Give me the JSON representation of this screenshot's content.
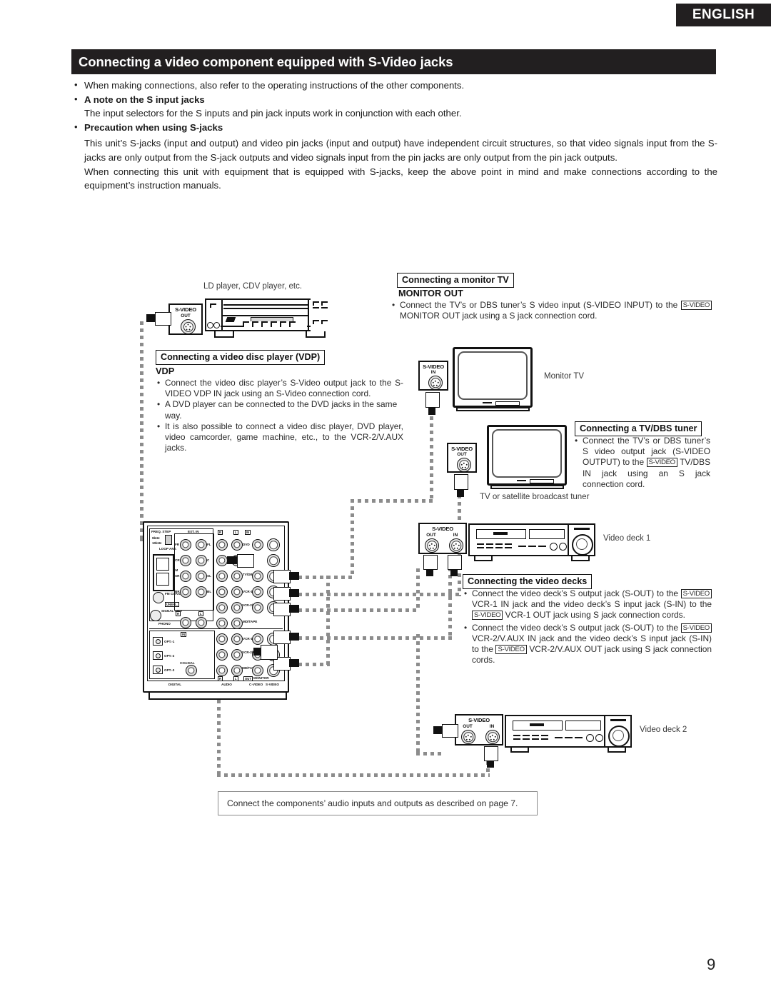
{
  "header": {
    "language_tab": "ENGLISH",
    "title": "Connecting a video component equipped with S-Video jacks"
  },
  "intro": {
    "bullet1": "When making connections, also refer to the operating instructions of the other components.",
    "bullet2_head": "A note on the S input jacks",
    "bullet2_body": "The input selectors for the S inputs and pin jack inputs work in conjunction with each other.",
    "bullet3_head": "Precaution when using S-jacks",
    "bullet3_p1": "This unit’s S-jacks (input and output) and video pin jacks (input and output) have independent circuit structures, so that video signals input  from the S-jacks are only output from the S-jack outputs and video signals input from the pin jacks are only output from the pin jack outputs.",
    "bullet3_p2": "When connecting this unit with equipment that is equipped with S-jacks, keep the above point in mind and make connections according to the equipment’s instruction manuals."
  },
  "diagram": {
    "ld_player_label": "LD player, CDV player, etc.",
    "monitor_tv_label": "Monitor TV",
    "tuner_label": "TV or satellite broadcast tuner",
    "video_deck_1_label": "Video deck 1",
    "video_deck_2_label": "Video deck 2",
    "jack_svideo": "S-VIDEO",
    "jack_out": "OUT",
    "jack_in": "IN"
  },
  "callouts": {
    "vdp": {
      "box": "Connecting a video disc player (VDP)",
      "heading": "VDP",
      "items": [
        "Connect the video disc player’s S-Video output jack to the S-VIDEO VDP IN jack using an S-Video connection cord.",
        "A DVD player can be connected to the DVD jacks in the same way.",
        "It is also possible to connect a video disc player, DVD player, video camcorder, game machine, etc., to the VCR-2/V.AUX jacks."
      ]
    },
    "monitor": {
      "box": "Connecting a monitor TV",
      "heading": "MONITOR OUT",
      "text_a": "Connect the TV’s or DBS tuner’s S video input (S-VIDEO INPUT) to the",
      "tag": "S-VIDEO",
      "text_b": "MONITOR OUT jack using a S jack connection cord."
    },
    "tuner": {
      "box": "Connecting a TV/DBS tuner",
      "text_a": "Connect the TV’s or DBS tuner’s S video output jack (S-VIDEO OUTPUT) to the",
      "tag": "S-VIDEO",
      "text_b": "TV/DBS IN jack using an S jack connection cord."
    },
    "decks": {
      "box": "Connecting the video decks",
      "item1_a": "Connect the video deck’s S output jack (S-OUT) to the",
      "item1_tag1": "S-VIDEO",
      "item1_b": "VCR-1 IN jack and the video deck’s S input jack (S-IN) to the",
      "item1_tag2": "S-VIDEO",
      "item1_c": "VCR-1 OUT jack using S jack connection cords.",
      "item2_a": "Connect the video deck’s S output jack (S-OUT) to the",
      "item2_tag1": "S-VIDEO",
      "item2_b": "VCR-2/V.AUX IN jack and the video deck’s S input jack (S-IN) to the",
      "item2_tag2": "S-VIDEO",
      "item2_c": "VCR-2/V.AUX OUT jack using S jack connection cords."
    }
  },
  "rear_panel": {
    "freq_step": "FREQ. STEP",
    "freq_9k": "9kHz",
    "freq_10k": "10kHz",
    "loop_ant": "LOOP ANT.",
    "am": "AM",
    "fm_coax": "FM COAX. 75Ω",
    "unbal": "UNBAL.",
    "signal_gnd": "SIGNAL GND",
    "phono": "PHONO",
    "ext_in": "EXT. IN",
    "ext_fr": "FR",
    "ext_fl": "FL",
    "ext_cr": "CR",
    "ext_c": "C",
    "ext_sr": "SR",
    "ext_sl": "SL",
    "ext_br": "BR",
    "ext_bl": "BL",
    "in_tag": "IN",
    "out_tag": "OUT",
    "r_tag": "R",
    "l_tag": "L",
    "rows_upper": [
      "DVD",
      "TV/DBS",
      "VCR-1",
      "VCR-2/V.AUX",
      "MD/TAPE"
    ],
    "rows_lower": [
      "VCR-1",
      "VCR-2/V.AUX",
      "MD/TAPE"
    ],
    "opt1": "OPT.-1",
    "opt2": "OPT.-2",
    "opt3": "OPT.-3",
    "coaxial": "COAXIAL",
    "monitor": "MONITOR",
    "bottom_digital": "DIGITAL",
    "bottom_audio": "AUDIO",
    "bottom_cvideo": "C-VIDEO",
    "bottom_svideo": "S-VIDEO"
  },
  "footer": {
    "note": "Connect the components’ audio inputs and outputs as described on page 7.",
    "page_number": "9"
  },
  "colors": {
    "ink": "#221f20",
    "paper": "#ffffff",
    "cable": "#8c8c8c"
  }
}
